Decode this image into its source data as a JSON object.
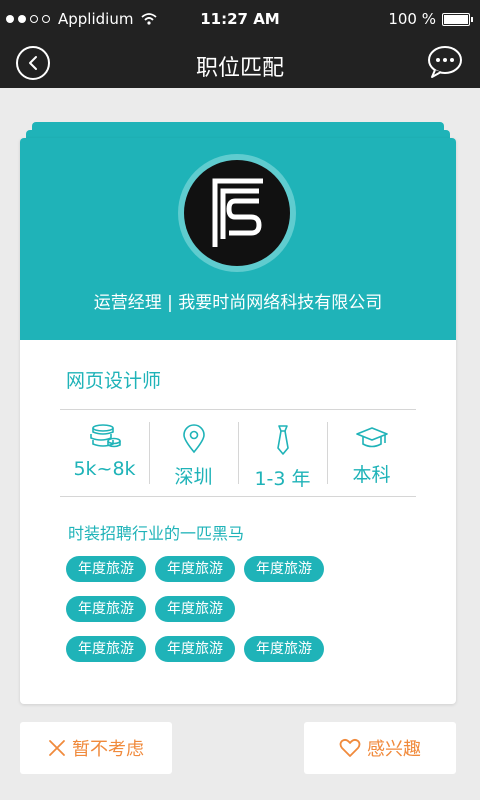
{
  "status_bar": {
    "carrier": "Applidium",
    "time": "11:27 AM",
    "battery": "100 %"
  },
  "nav": {
    "title": "职位匹配"
  },
  "card": {
    "company_line": "运营经理 | 我要时尚网络科技有限公司",
    "job_title": "网页设计师",
    "stats": {
      "salary": "5k~8k",
      "city": "深圳",
      "experience": "1-3 年",
      "education": "本科"
    },
    "slogan": "时装招聘行业的一匹黑马",
    "tags": [
      [
        "年度旅游",
        "年度旅游",
        "年度旅游"
      ],
      [
        "年度旅游",
        "年度旅游"
      ],
      [
        "年度旅游",
        "年度旅游",
        "年度旅游"
      ]
    ]
  },
  "actions": {
    "skip_label": "暂不考虑",
    "like_label": "感兴趣"
  },
  "colors": {
    "accent": "#1fb3b8",
    "action": "#f08a3c",
    "header_bg": "#222222"
  }
}
